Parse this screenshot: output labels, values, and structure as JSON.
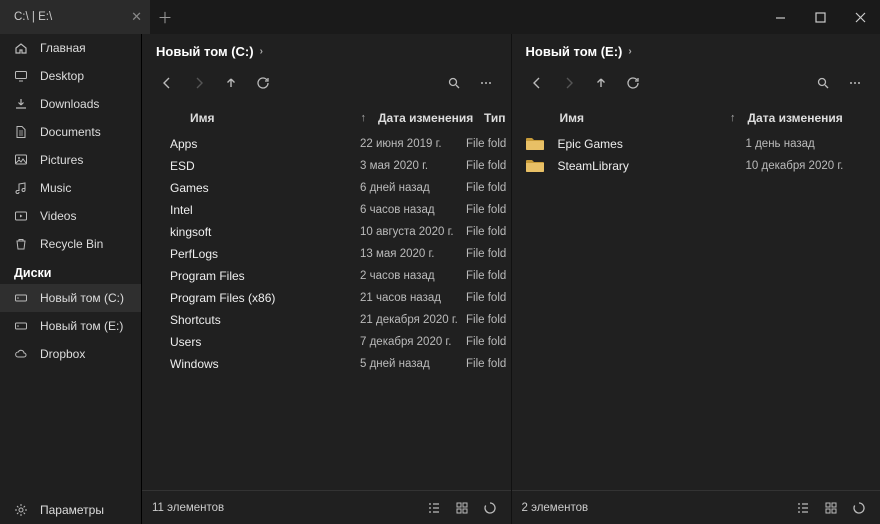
{
  "tab_title": "C:\\ | E:\\",
  "sidebar": {
    "items": [
      {
        "label": "Главная",
        "icon": "home"
      },
      {
        "label": "Desktop",
        "icon": "desktop"
      },
      {
        "label": "Downloads",
        "icon": "download"
      },
      {
        "label": "Documents",
        "icon": "document"
      },
      {
        "label": "Pictures",
        "icon": "picture"
      },
      {
        "label": "Music",
        "icon": "music"
      },
      {
        "label": "Videos",
        "icon": "video"
      },
      {
        "label": "Recycle Bin",
        "icon": "recycle"
      }
    ],
    "section_label": "Диски",
    "drives": [
      {
        "label": "Новый том (C:)",
        "active": true
      },
      {
        "label": "Новый том (E:)",
        "active": false
      },
      {
        "label": "Dropbox",
        "active": false,
        "icon": "cloud"
      }
    ],
    "settings_label": "Параметры"
  },
  "panes": [
    {
      "title": "Новый том (C:)",
      "columns": {
        "name": "Имя",
        "date": "Дата изменения",
        "type": "Тип"
      },
      "rows": [
        {
          "name": "Apps",
          "date": "22 июня 2019 г.",
          "type": "File fold"
        },
        {
          "name": "ESD",
          "date": "3 мая 2020 г.",
          "type": "File fold"
        },
        {
          "name": "Games",
          "date": "6 дней назад",
          "type": "File fold"
        },
        {
          "name": "Intel",
          "date": "6 часов назад",
          "type": "File fold"
        },
        {
          "name": "kingsoft",
          "date": "10 августа 2020 г.",
          "type": "File fold"
        },
        {
          "name": "PerfLogs",
          "date": "13 мая 2020 г.",
          "type": "File fold"
        },
        {
          "name": "Program Files",
          "date": "2 часов назад",
          "type": "File fold"
        },
        {
          "name": "Program Files (x86)",
          "date": "21 часов назад",
          "type": "File fold"
        },
        {
          "name": "Shortcuts",
          "date": "21 декабря 2020 г.",
          "type": "File fold"
        },
        {
          "name": "Users",
          "date": "7 декабря 2020 г.",
          "type": "File fold"
        },
        {
          "name": "Windows",
          "date": "5 дней назад",
          "type": "File fold"
        }
      ],
      "status": "11 элементов"
    },
    {
      "title": "Новый том (E:)",
      "columns": {
        "name": "Имя",
        "date": "Дата изменения"
      },
      "rows": [
        {
          "name": "Epic Games",
          "date": "1 день назад"
        },
        {
          "name": "SteamLibrary",
          "date": "10 декабря 2020 г."
        }
      ],
      "status": "2 элементов"
    }
  ]
}
